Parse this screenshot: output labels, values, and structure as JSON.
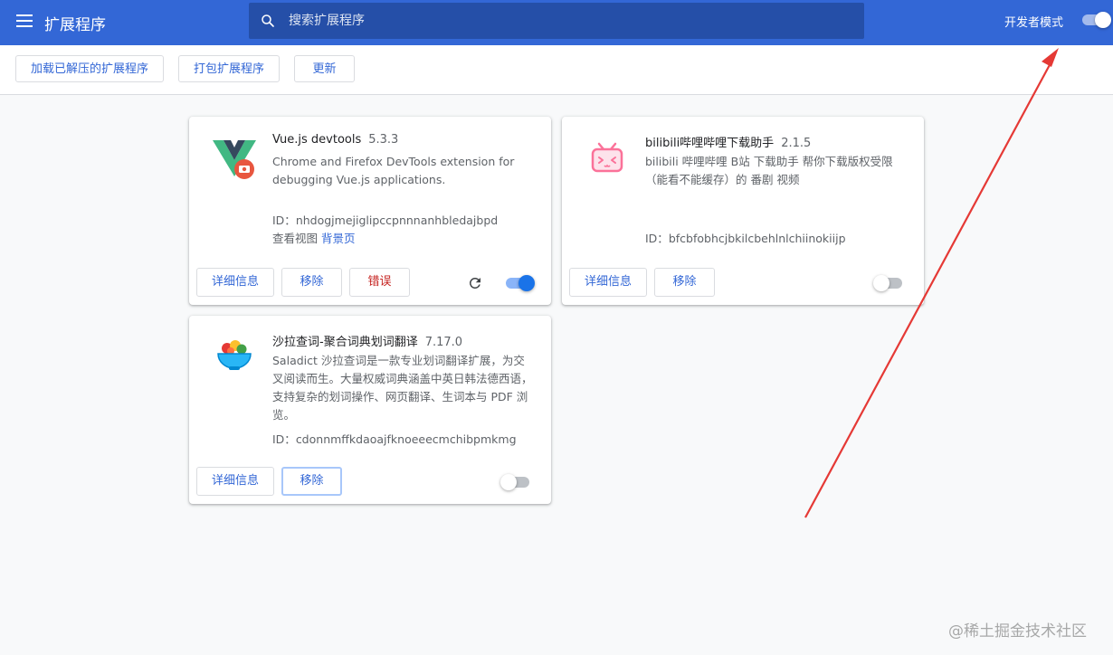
{
  "header": {
    "title": "扩展程序",
    "search_placeholder": "搜索扩展程序",
    "dev_mode_label": "开发者模式",
    "dev_mode_on": true
  },
  "toolbar": {
    "load_unpacked": "加载已解压的扩展程序",
    "pack": "打包扩展程序",
    "update": "更新"
  },
  "extensions": [
    {
      "name": "Vue.js devtools",
      "version": "5.3.3",
      "description": "Chrome and Firefox DevTools extension for debugging Vue.js applications.",
      "id_label": "ID：",
      "id": "nhdogjmejiglipccpnnnanhbledajbpd",
      "view_label": "查看视图",
      "view_link": "背景页",
      "details": "详细信息",
      "remove": "移除",
      "errors": "错误",
      "enabled": true
    },
    {
      "name": "bilibili哔哩哔哩下载助手",
      "version": "2.1.5",
      "description": "bilibili 哔哩哔哩 B站 下载助手 帮你下载版权受限（能看不能缓存）的 番剧 视频",
      "id_label": "ID：",
      "id": "bfcbfobhcjbkilcbehlnlchiinokiijp",
      "details": "详细信息",
      "remove": "移除",
      "enabled": false
    },
    {
      "name": "沙拉查词-聚合词典划词翻译",
      "version": "7.17.0",
      "description": "Saladict 沙拉查词是一款专业划词翻译扩展，为交叉阅读而生。大量权威词典涵盖中英日韩法德西语，支持复杂的划词操作、网页翻译、生词本与 PDF 浏览。",
      "id_label": "ID：",
      "id": "cdonnmffkdaoajfknoeeecmchibpmkmg",
      "details": "详细信息",
      "remove": "移除",
      "enabled": false
    }
  ],
  "watermark": "@稀土掘金技术社区",
  "colors": {
    "header_bg": "#3367d6",
    "search_bg": "#254fa8",
    "link": "#3367d6",
    "error": "#c5221f",
    "toggle_on": "#1a73e8",
    "annotation_arrow": "#e53935"
  }
}
